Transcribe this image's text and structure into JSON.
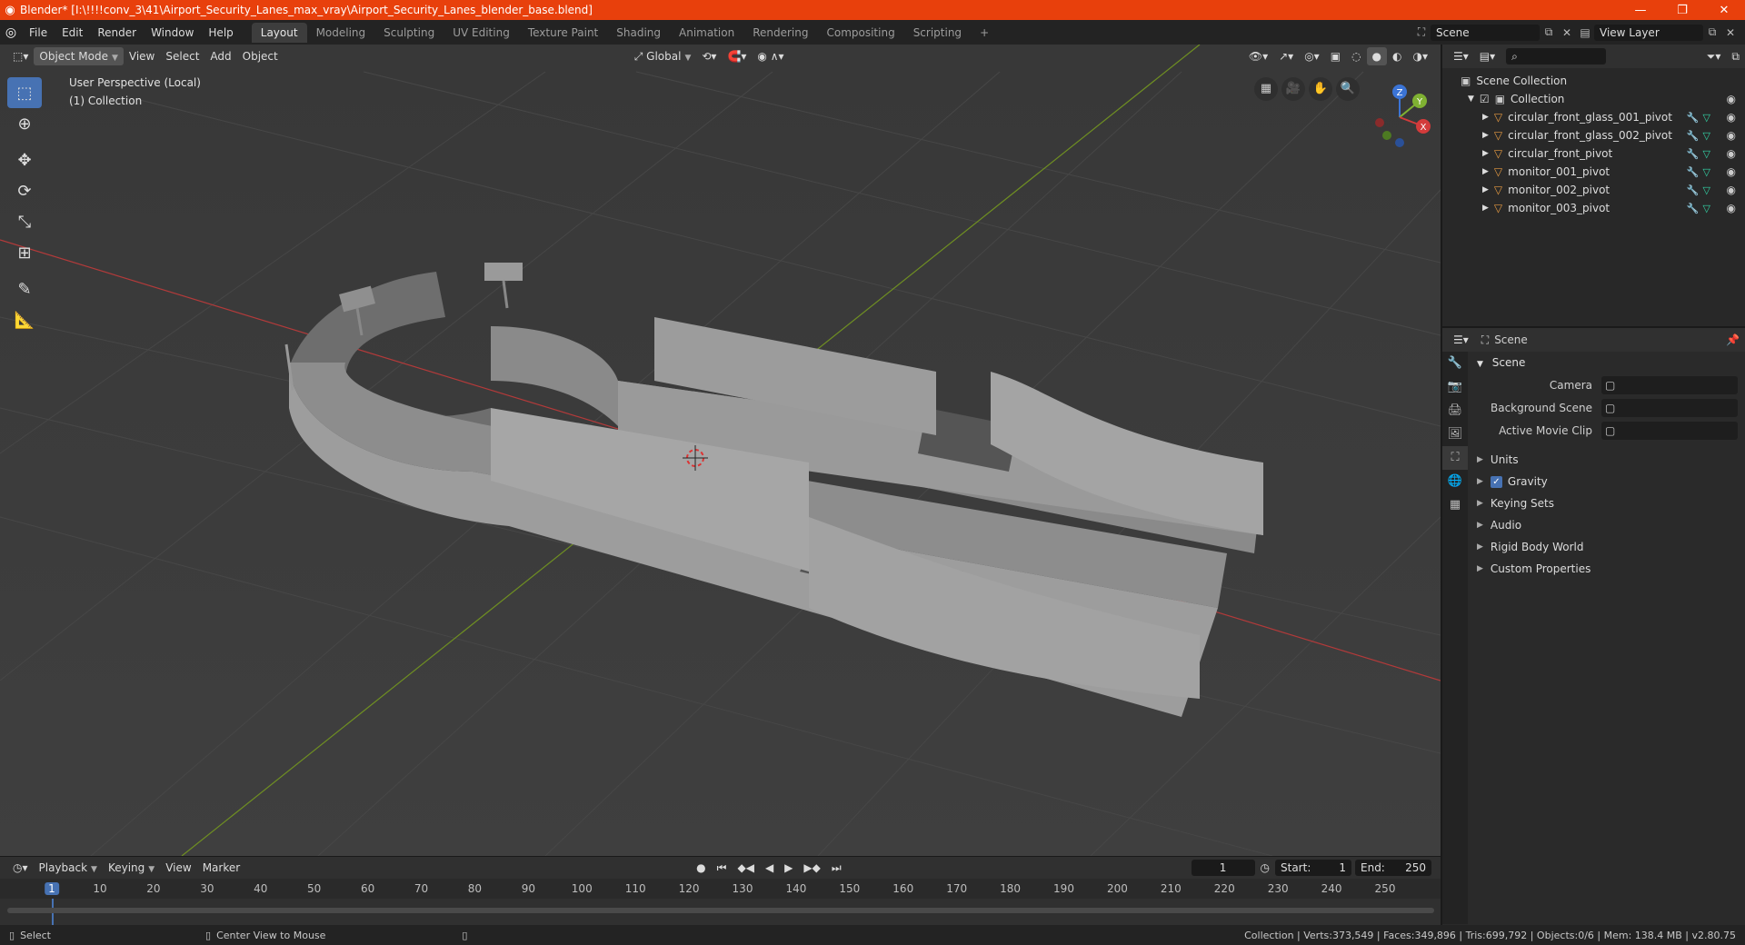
{
  "window": {
    "title": "Blender* [I:\\!!!!conv_3\\41\\Airport_Security_Lanes_max_vray\\Airport_Security_Lanes_blender_base.blend]",
    "minimize": "—",
    "restore": "❐",
    "close": "✕"
  },
  "menubar": {
    "items": [
      "File",
      "Edit",
      "Render",
      "Window",
      "Help"
    ],
    "workspaces": [
      "Layout",
      "Modeling",
      "Sculpting",
      "UV Editing",
      "Texture Paint",
      "Shading",
      "Animation",
      "Rendering",
      "Compositing",
      "Scripting"
    ],
    "active_workspace": "Layout",
    "add_tab": "+",
    "scene": "Scene",
    "view_layer": "View Layer"
  },
  "viewport": {
    "mode": "Object Mode",
    "menus": [
      "View",
      "Select",
      "Add",
      "Object"
    ],
    "transform_orientation": "Global",
    "info_line1": "User Perspective (Local)",
    "info_line2": "(1) Collection",
    "gizmo": {
      "x": "X",
      "y": "Y",
      "z": "Z"
    }
  },
  "outliner": {
    "root": "Scene Collection",
    "collection": "Collection",
    "objects": [
      "circular_front_glass_001_pivot",
      "circular_front_glass_002_pivot",
      "circular_front_pivot",
      "monitor_001_pivot",
      "monitor_002_pivot",
      "monitor_003_pivot"
    ]
  },
  "properties": {
    "context": "Scene",
    "panel": "Scene",
    "fields": [
      {
        "label": "Camera",
        "value": ""
      },
      {
        "label": "Background Scene",
        "value": ""
      },
      {
        "label": "Active Movie Clip",
        "value": ""
      }
    ],
    "subpanels": [
      "Units",
      "Gravity",
      "Keying Sets",
      "Audio",
      "Rigid Body World",
      "Custom Properties"
    ],
    "gravity_checked": true
  },
  "timeline": {
    "menus": [
      "Playback",
      "Keying",
      "View",
      "Marker"
    ],
    "current_frame": "1",
    "start_label": "Start:",
    "start": "1",
    "end_label": "End:",
    "end": "250",
    "ticks": [
      "1",
      "10",
      "20",
      "30",
      "40",
      "50",
      "60",
      "70",
      "80",
      "90",
      "100",
      "110",
      "120",
      "130",
      "140",
      "150",
      "160",
      "170",
      "180",
      "190",
      "200",
      "210",
      "220",
      "230",
      "240",
      "250"
    ]
  },
  "statusbar": {
    "select": "Select",
    "center_view": "Center View to Mouse",
    "stats": "Collection | Verts:373,549 | Faces:349,896 | Tris:699,792 | Objects:0/6 | Mem: 138.4 MB | v2.80.75"
  },
  "colors": {
    "title_bar": "#e8400c",
    "viewport_bg": "#3d3d3d",
    "accent": "#4772b3",
    "axis_x": "#c8413f",
    "axis_y": "#7ea32a"
  }
}
